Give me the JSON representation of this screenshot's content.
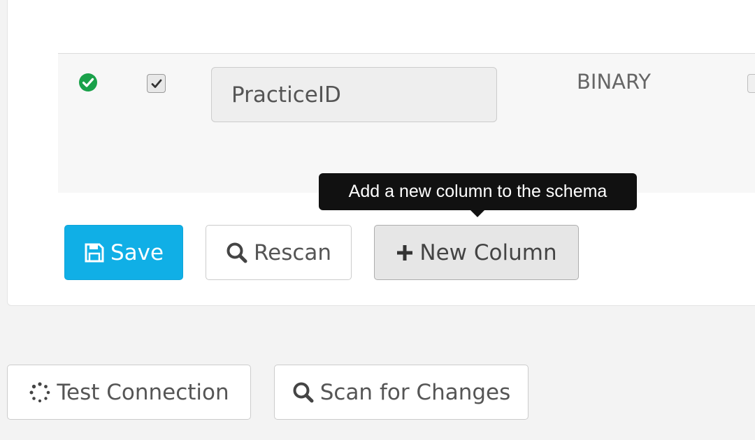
{
  "schema_row": {
    "status_icon": "check-circle-icon",
    "included_checked": true,
    "column_name": "PracticeID",
    "column_type": "BINARY"
  },
  "actions": {
    "save_label": "Save",
    "rescan_label": "Rescan",
    "new_column_label": "New Column"
  },
  "tooltip": {
    "text": "Add a new column to the schema"
  },
  "connection_actions": {
    "test_connection_label": "Test Connection",
    "scan_for_changes_label": "Scan for Changes"
  },
  "colors": {
    "primary": "#10afe6",
    "success": "#1aa14a",
    "tooltip_bg": "#111111"
  }
}
